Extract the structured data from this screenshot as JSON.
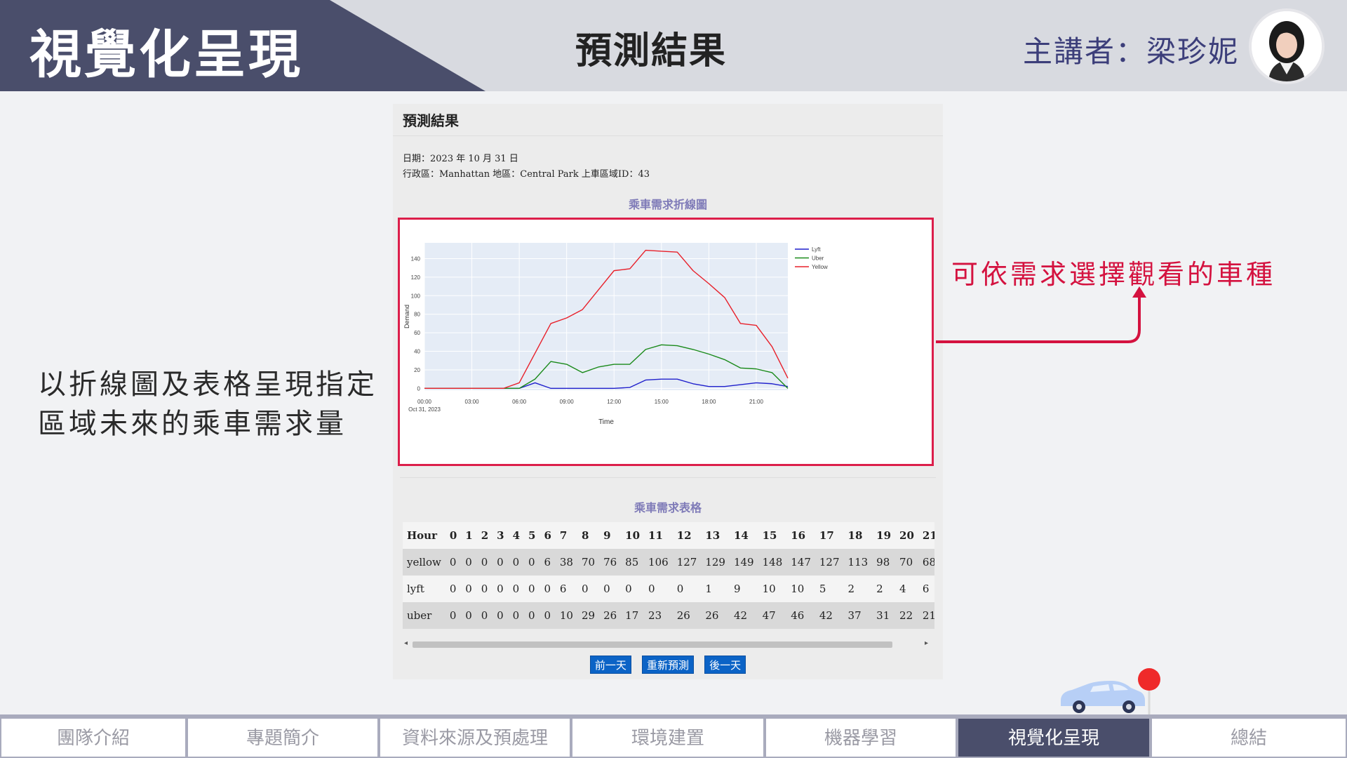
{
  "header": {
    "section_title": "視覺化呈現",
    "slide_title": "預測結果",
    "presenter": "主講者：梁珍妮"
  },
  "left_text": {
    "line1": "以折線圖及表格呈現指定",
    "line2": "區域未來的乘車需求量"
  },
  "annotation": {
    "text": "可依需求選擇觀看的車種"
  },
  "card": {
    "title": "預測結果",
    "date_line": "日期：2023 年 10 月 31 日",
    "location_line": "行政區：Manhattan  地區：Central Park  上車區域ID：43",
    "chart_title": "乘車需求折線圖",
    "table_title": "乘車需求表格",
    "buttons": {
      "prev": "前一天",
      "refresh": "重新預測",
      "next": "後一天"
    }
  },
  "chart_data": {
    "type": "line",
    "xlabel": "Time",
    "ylabel": "Demand",
    "x_unit": "hour",
    "x": [
      0,
      1,
      2,
      3,
      4,
      5,
      6,
      7,
      8,
      9,
      10,
      11,
      12,
      13,
      14,
      15,
      16,
      17,
      18,
      19,
      20,
      21,
      22,
      23
    ],
    "x_tick_labels": [
      "00:00",
      "03:00",
      "06:00",
      "09:00",
      "12:00",
      "15:00",
      "18:00",
      "21:00"
    ],
    "x_tick_values": [
      0,
      3,
      6,
      9,
      12,
      15,
      18,
      21
    ],
    "x_date_label": "Oct 31, 2023",
    "y_ticks": [
      0,
      20,
      40,
      60,
      80,
      100,
      120,
      140
    ],
    "ylim": [
      -2,
      157
    ],
    "xlim": [
      0,
      23
    ],
    "grid": true,
    "legend_position": "top-right",
    "series": [
      {
        "name": "Lyft",
        "color": "#1f1fcc",
        "values": [
          0,
          0,
          0,
          0,
          0,
          0,
          0,
          6,
          0,
          0,
          0,
          0,
          0,
          1,
          9,
          10,
          10,
          5,
          2,
          2,
          4,
          6,
          5,
          2
        ]
      },
      {
        "name": "Uber",
        "color": "#1a8a1a",
        "values": [
          0,
          0,
          0,
          0,
          0,
          0,
          0,
          10,
          29,
          26,
          17,
          23,
          26,
          26,
          42,
          47,
          46,
          42,
          37,
          31,
          22,
          21,
          17,
          0
        ]
      },
      {
        "name": "Yellow",
        "color": "#e8202a",
        "values": [
          0,
          0,
          0,
          0,
          0,
          0,
          6,
          38,
          70,
          76,
          85,
          106,
          127,
          129,
          149,
          148,
          147,
          127,
          113,
          98,
          70,
          68,
          45,
          11
        ]
      }
    ]
  },
  "table": {
    "columns": [
      "Hour",
      "0",
      "1",
      "2",
      "3",
      "4",
      "5",
      "6",
      "7",
      "8",
      "9",
      "10",
      "11",
      "12",
      "13",
      "14",
      "15",
      "16",
      "17",
      "18",
      "19",
      "20",
      "21"
    ],
    "rows": [
      [
        "yellow",
        "0",
        "0",
        "0",
        "0",
        "0",
        "0",
        "6",
        "38",
        "70",
        "76",
        "85",
        "106",
        "127",
        "129",
        "149",
        "148",
        "147",
        "127",
        "113",
        "98",
        "70",
        "68"
      ],
      [
        "lyft",
        "0",
        "0",
        "0",
        "0",
        "0",
        "0",
        "0",
        "6",
        "0",
        "0",
        "0",
        "0",
        "0",
        "1",
        "9",
        "10",
        "10",
        "5",
        "2",
        "2",
        "4",
        "6"
      ],
      [
        "uber",
        "0",
        "0",
        "0",
        "0",
        "0",
        "0",
        "0",
        "10",
        "29",
        "26",
        "17",
        "23",
        "26",
        "26",
        "42",
        "47",
        "46",
        "42",
        "37",
        "31",
        "22",
        "21"
      ]
    ]
  },
  "nav": {
    "items": [
      "團隊介紹",
      "專題簡介",
      "資料來源及預處理",
      "環境建置",
      "機器學習",
      "視覺化呈現",
      "總結"
    ],
    "active": "視覺化呈現"
  },
  "colors": {
    "header_dark": "#4a4e6b",
    "header_light": "#d8dae0",
    "accent_red": "#d4123f",
    "button_blue": "#0b63c6",
    "chart_title": "#7f7bb8"
  }
}
